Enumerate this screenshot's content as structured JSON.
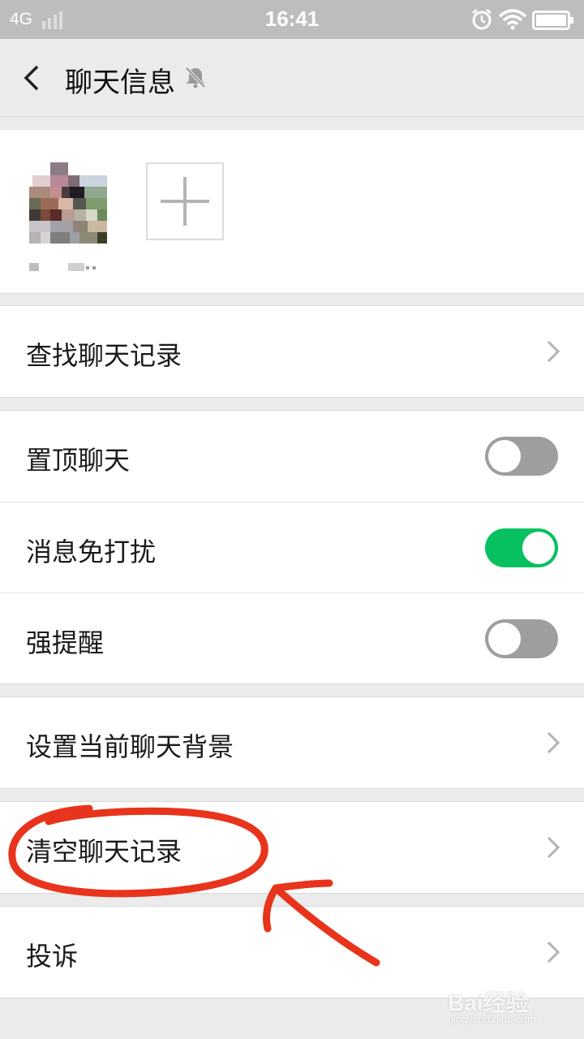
{
  "status_bar": {
    "network": "4G",
    "time": "16:41",
    "icons": [
      "signal-icon",
      "alarm-icon",
      "wifi-icon",
      "battery-icon"
    ]
  },
  "nav": {
    "title": "聊天信息",
    "back_icon": "chevron-left-icon",
    "mute_icon": "bell-off-icon"
  },
  "members": {
    "add_icon": "plus-icon"
  },
  "settings": {
    "search_history": "查找聊天记录",
    "pin_chat": {
      "label": "置顶聊天",
      "on": false
    },
    "do_not_disturb": {
      "label": "消息免打扰",
      "on": true
    },
    "strong_reminder": {
      "label": "强提醒",
      "on": false
    },
    "chat_background": "设置当前聊天背景",
    "clear_history": "清空聊天记录",
    "report": "投诉"
  },
  "watermark": {
    "logo": "Bai经验",
    "url": "jingyan.baidu.com"
  },
  "colors": {
    "toggle_on": "#07c160",
    "toggle_off": "#9e9e9e",
    "annotation": "#e8341c"
  }
}
